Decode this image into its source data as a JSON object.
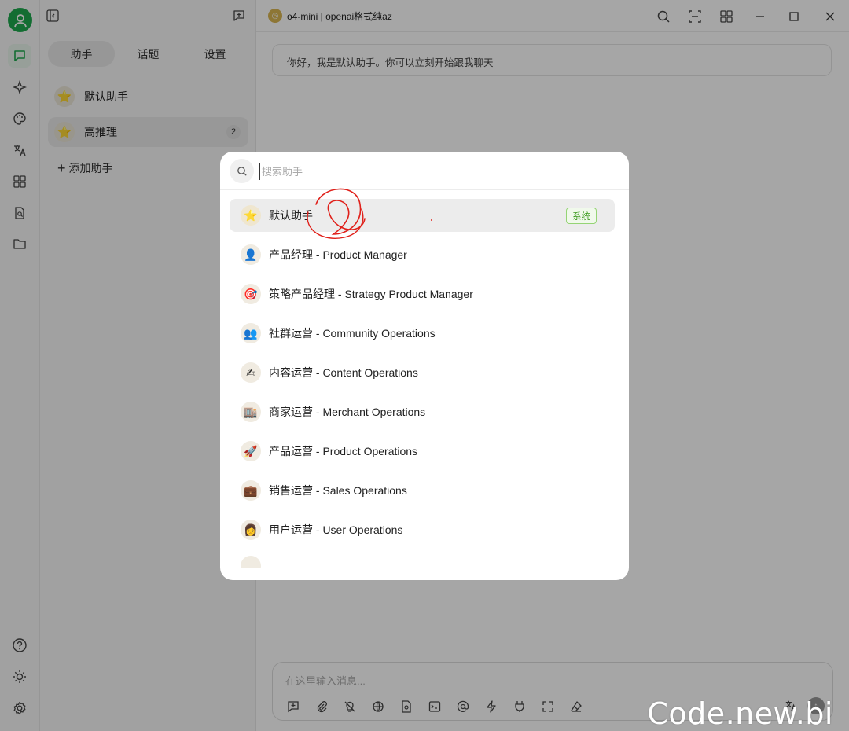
{
  "sidebar_rail": {
    "items": [
      {
        "icon": "chat-icon"
      },
      {
        "icon": "sparkle-icon"
      },
      {
        "icon": "palette-icon"
      },
      {
        "icon": "translate-icon"
      },
      {
        "icon": "apps-grid-icon"
      },
      {
        "icon": "file-search-icon"
      },
      {
        "icon": "folder-icon"
      }
    ],
    "bottom": [
      {
        "icon": "help-icon"
      },
      {
        "icon": "brightness-icon"
      },
      {
        "icon": "settings-icon"
      }
    ]
  },
  "panel": {
    "tabs": [
      {
        "label": "助手"
      },
      {
        "label": "话题"
      },
      {
        "label": "设置"
      }
    ],
    "active_tab": 0,
    "assistants": [
      {
        "emoji": "⭐",
        "name": "默认助手"
      },
      {
        "emoji": "⭐",
        "name": "高推理",
        "count": "2"
      }
    ],
    "add_label": "添加助手"
  },
  "topbar": {
    "model_label": "o4-mini | openai格式纯az"
  },
  "chat": {
    "welcome": "你好，我是默认助手。你可以立刻开始跟我聊天",
    "input_placeholder": "在这里输入消息..."
  },
  "modal": {
    "search_placeholder": "搜索助手",
    "items": [
      {
        "emoji": "⭐",
        "label": "默认助手",
        "tag": "系统"
      },
      {
        "emoji": "👤",
        "label": "产品经理 - Product Manager"
      },
      {
        "emoji": "🎯",
        "label": "策略产品经理 - Strategy Product Manager"
      },
      {
        "emoji": "👥",
        "label": "社群运营 - Community Operations"
      },
      {
        "emoji": "✍",
        "label": "内容运营 - Content Operations"
      },
      {
        "emoji": "🏬",
        "label": "商家运营 - Merchant Operations"
      },
      {
        "emoji": "🚀",
        "label": "产品运营 - Product Operations"
      },
      {
        "emoji": "💼",
        "label": "销售运营 - Sales Operations"
      },
      {
        "emoji": "👩",
        "label": "用户运营 - User Operations"
      }
    ]
  },
  "colors": {
    "accent": "#1ea84d",
    "overlay": "rgba(0,0,0,0.35)",
    "tag_green": "#3a9a1d",
    "annotation_red": "#e0201a"
  },
  "watermark": "Code.new.bi"
}
